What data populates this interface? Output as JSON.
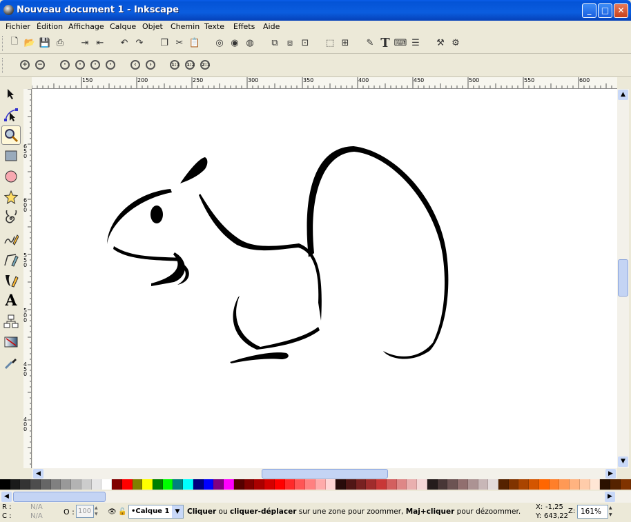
{
  "window": {
    "title": "Nouveau document 1 - Inkscape",
    "minimize_icon": "minimize-icon",
    "maximize_icon": "maximize-icon",
    "close_icon": "close-icon"
  },
  "menu": [
    "Fichier",
    "Édition",
    "Affichage",
    "Calque",
    "Objet",
    "Chemin",
    "Texte",
    "Effets",
    "Aide"
  ],
  "zoom_toolbar": {
    "z11": "1:1",
    "z12": "1:2",
    "z21": "2:1"
  },
  "ruler": {
    "h": [
      "150",
      "200",
      "250",
      "300",
      "350",
      "400",
      "450",
      "500",
      "550",
      "600"
    ],
    "v": [
      "650",
      "600",
      "550",
      "500",
      "450",
      "400"
    ]
  },
  "status": {
    "r_label": "R :",
    "r_value": "N/A",
    "c_label": "C :",
    "c_value": "N/A",
    "o_label": "O :",
    "o_value": "100",
    "layer": "•Calque 1",
    "msg_b1": "Cliquer",
    "msg_t1": " ou ",
    "msg_b2": "cliquer-déplacer",
    "msg_t2": " sur une zone pour zoommer, ",
    "msg_b3": "Maj+cliquer",
    "msg_t3": " pour dézoommer.",
    "x_label": "X:",
    "x_value": "-1,25",
    "y_label": "Y:",
    "y_value": "643,22",
    "z_label": "Z:",
    "zoom": "161%"
  },
  "palette": [
    "#000000",
    "#1a1a1a",
    "#333333",
    "#4d4d4d",
    "#666666",
    "#808080",
    "#999999",
    "#b3b3b3",
    "#cccccc",
    "#e6e6e6",
    "#ffffff",
    "#800000",
    "#ff0000",
    "#808000",
    "#ffff00",
    "#008000",
    "#00ff00",
    "#008080",
    "#00ffff",
    "#000080",
    "#0000ff",
    "#800080",
    "#ff00ff",
    "#550000",
    "#800000",
    "#aa0000",
    "#d40000",
    "#ff0000",
    "#ff2a2a",
    "#ff5555",
    "#ff8080",
    "#ffaaaa",
    "#ffd5d5",
    "#280b0b",
    "#501616",
    "#782121",
    "#a02c2c",
    "#c83737",
    "#d35f5f",
    "#de8787",
    "#e9afaf",
    "#f4d7d7",
    "#241c1c",
    "#483737",
    "#6c5353",
    "#916f6f",
    "#ac9393",
    "#c8b7b7",
    "#e3dbdb",
    "#552200",
    "#803300",
    "#aa4400",
    "#d45500",
    "#ff6600",
    "#ff7f2a",
    "#ff9955",
    "#ffb380",
    "#ffccaa",
    "#ffe6d5",
    "#2b1100",
    "#552200",
    "#803300"
  ]
}
